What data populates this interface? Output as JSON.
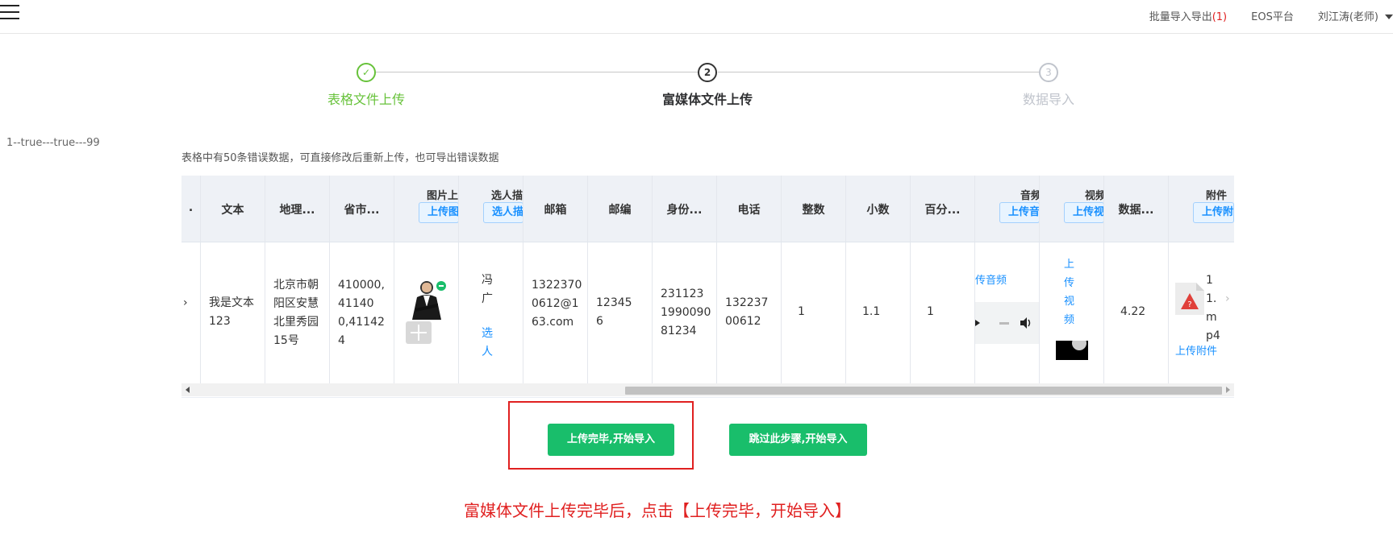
{
  "topbar": {
    "import_export_label": "批量导入导出",
    "import_export_count": "(1)",
    "eos_label": "EOS平台",
    "user_label": "刘江涛(老师)"
  },
  "steps": [
    {
      "number": "✓",
      "title": "表格文件上传",
      "status": "done"
    },
    {
      "number": "2",
      "title": "富媒体文件上传",
      "status": "active"
    },
    {
      "number": "3",
      "title": "数据导入",
      "status": "wait"
    }
  ],
  "debug_text": "1--true---true---99",
  "notice": "表格中有50条错误数据，可直接修改后重新上传，也可导出错误数据",
  "table": {
    "headers": {
      "first_partial": ".",
      "text": "文本",
      "geo": "地理...",
      "province": "省市...",
      "image_top": "图片上",
      "image_btn": "上传图",
      "pick_top": "选人描",
      "pick_btn": "选人描",
      "email": "邮箱",
      "zip": "邮编",
      "idcard": "身份...",
      "phone": "电话",
      "integer": "整数",
      "decimal": "小数",
      "percent": "百分...",
      "audio_top": "音频",
      "audio_btn": "上传音",
      "video_top": "视频",
      "video_btn": "上传视",
      "data": "数据...",
      "attach_top": "附件",
      "attach_btn": "上传附"
    },
    "row": {
      "first_partial": "›",
      "text": "我是文本123",
      "geo": "北京市朝阳区安慧北里秀园15号",
      "province": "410000,41140 0,411424",
      "pick_name": "冯广",
      "pick_link": "选人",
      "email": "13223700612@163.com",
      "zip": "123456",
      "idcard": "231123 1990090 81234",
      "phone": "13223700612",
      "integer": "1",
      "decimal": "1.1",
      "percent": "1",
      "audio_link": "传音频",
      "video_link": "上传视频",
      "data": "4.22",
      "attach_name": "11.mp4",
      "attach_link": "上传附件"
    }
  },
  "buttons": {
    "primary": "上传完毕,开始导入",
    "skip": "跳过此步骤,开始导入"
  },
  "tip": "富媒体文件上传完毕后，点击【上传完毕，开始导入】",
  "colors": {
    "success": "#19be6b",
    "highlight": "#e02020",
    "link": "#1890ff"
  }
}
